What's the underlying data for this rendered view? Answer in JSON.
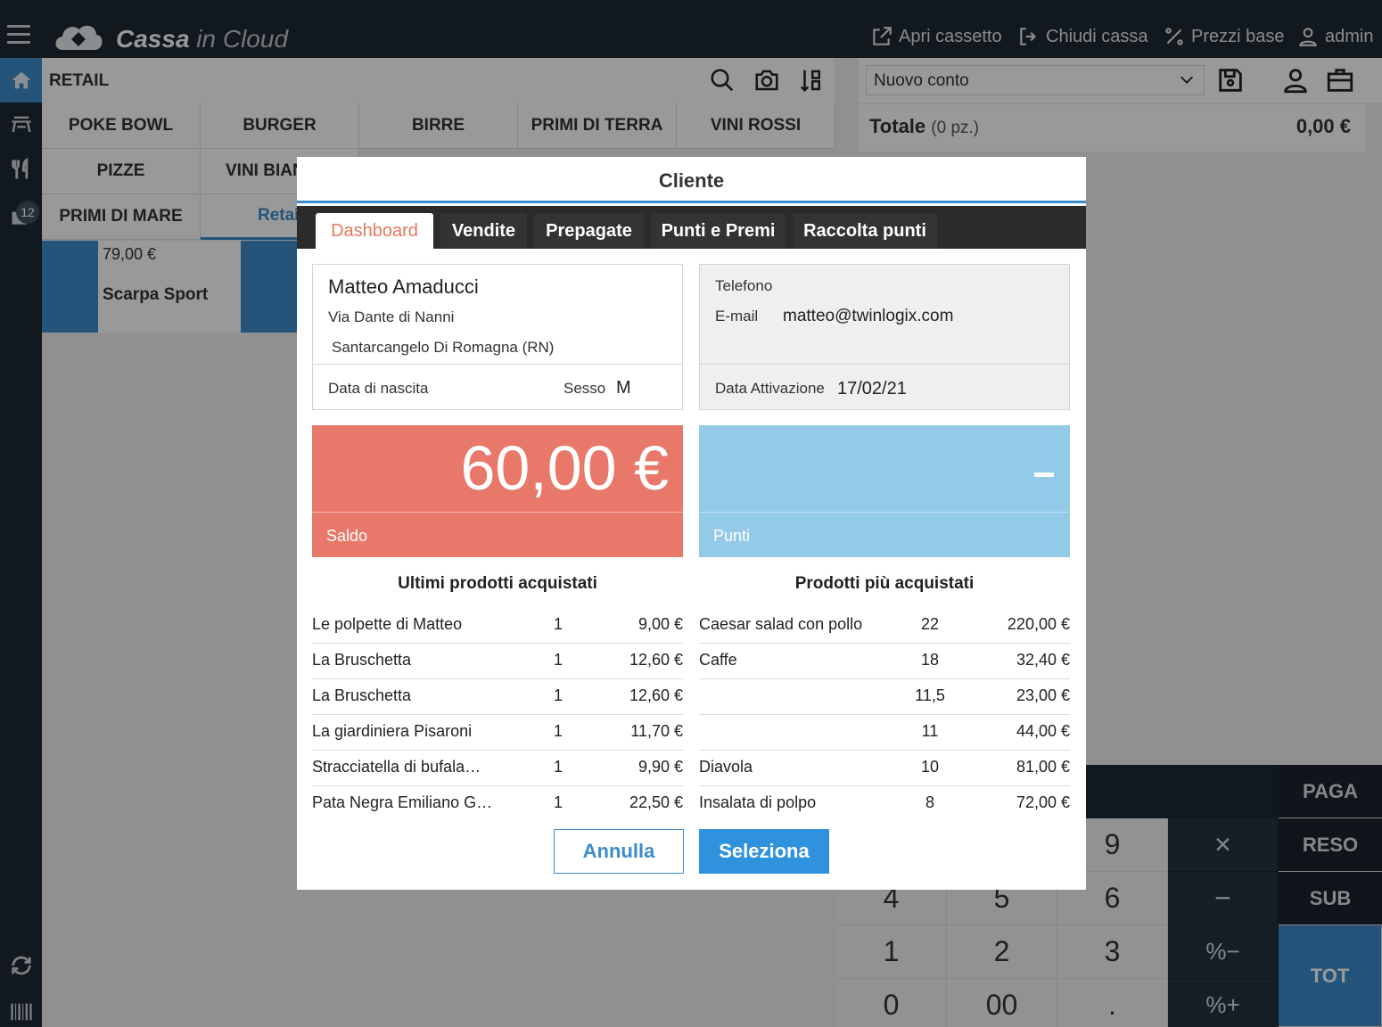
{
  "header": {
    "brand_bold": "Cassa",
    "brand_rest": " in Cloud",
    "actions": [
      "Apri cassetto",
      "Chiudi cassa",
      "Prezzi base",
      "admin"
    ]
  },
  "sidebar": {
    "badge": "12"
  },
  "left_panel": {
    "title": "RETAIL",
    "categories": [
      "POKE BOWL",
      "BURGER",
      "BIRRE",
      "PRIMI DI TERRA",
      "VINI ROSSI",
      "PIZZE",
      "VINI BIAN",
      "PRIMI DI MARE",
      "Retai"
    ],
    "product": {
      "price": "79,00 €",
      "name": "Scarpa Sport"
    }
  },
  "right_panel": {
    "account": "Nuovo conto",
    "total_label": "Totale",
    "total_qty": "(0 pz.)",
    "total_value": "0,00 €"
  },
  "keypad": {
    "keys": [
      "9",
      "4",
      "5",
      "6",
      "1",
      "2",
      "3",
      "0",
      "00",
      "."
    ],
    "ops": [
      "×",
      "−",
      "%−",
      "%+"
    ],
    "functions": [
      "PAGA",
      "RESO",
      "SUB",
      "TOT"
    ]
  },
  "modal": {
    "title": "Cliente",
    "tabs": [
      "Dashboard",
      "Vendite",
      "Prepagate",
      "Punti e Premi",
      "Raccolta punti"
    ],
    "customer": {
      "name": "Matteo Amaducci",
      "address1": "Via Dante di Nanni",
      "address2": "Santarcangelo Di Romagna (RN)",
      "birth_label": "Data di nascita",
      "sex_label": "Sesso",
      "sex_value": "M"
    },
    "contact": {
      "phone_label": "Telefono",
      "email_label": "E-mail",
      "email_value": "matteo@twinlogix.com",
      "activation_label": "Data Attivazione",
      "activation_value": "17/02/21"
    },
    "saldo": {
      "value": "60,00 €",
      "label": "Saldo",
      "color": "#e8786a"
    },
    "punti": {
      "label": "Punti",
      "color": "#93cae8"
    },
    "last_products": {
      "title": "Ultimi prodotti acquistati",
      "rows": [
        {
          "name": "Le polpette di Matteo",
          "qty": "1",
          "price": "9,00 €"
        },
        {
          "name": "La Bruschetta",
          "qty": "1",
          "price": "12,60 €"
        },
        {
          "name": "La Bruschetta",
          "qty": "1",
          "price": "12,60 €"
        },
        {
          "name": "La giardiniera Pisaroni",
          "qty": "1",
          "price": "11,70 €"
        },
        {
          "name": "Stracciatella di bufala…",
          "qty": "1",
          "price": "9,90 €"
        },
        {
          "name": "Pata Negra Emiliano G…",
          "qty": "1",
          "price": "22,50 €"
        }
      ]
    },
    "top_products": {
      "title": "Prodotti più acquistati",
      "rows": [
        {
          "name": "Caesar salad con pollo",
          "qty": "22",
          "price": "220,00 €"
        },
        {
          "name": "Caffe",
          "qty": "18",
          "price": "32,40 €"
        },
        {
          "name": "",
          "qty": "11,5",
          "price": "23,00 €"
        },
        {
          "name": "",
          "qty": "11",
          "price": "44,00 €"
        },
        {
          "name": "Diavola",
          "qty": "10",
          "price": "81,00 €"
        },
        {
          "name": "Insalata di polpo",
          "qty": "8",
          "price": "72,00 €"
        }
      ]
    },
    "buttons": {
      "cancel": "Annulla",
      "select": "Seleziona"
    }
  }
}
